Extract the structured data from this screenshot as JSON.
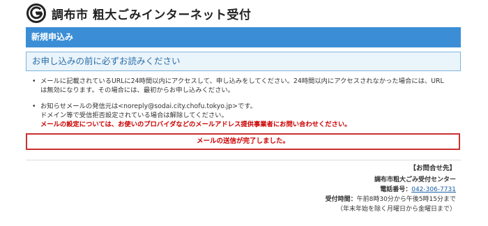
{
  "header": {
    "logo_icon": "chofu-city-logo-icon",
    "title": "調布市 粗大ごみインターネット受付"
  },
  "section": {
    "title": "新規申込み"
  },
  "notice": {
    "text": "お申し込みの前に必ずお読みください"
  },
  "instructions": {
    "item1_line1": "メールに記載されているURLに24時間以内にアクセスして、申し込みをしてください。24時間以内にアクセスされなかった場合には、URL",
    "item1_line2": "は無効になります。その場合には、最初からお申し込みください。",
    "item2_line1": "お知らせメールの発信元は<noreply@sodai.city.chofu.tokyo.jp>です。",
    "item2_line2": "ドメイン等で受信拒否設定されている場合は解除してください。",
    "item2_line3": "メールの設定については、お使いのプロバイダなどのメールアドレス提供事業者にお問い合わせください。"
  },
  "alert": {
    "text": "メールの送信が完了しました。"
  },
  "contact": {
    "heading": "【お問合せ先】",
    "center": "調布市粗大ごみ受付センター",
    "phone_label": "電話番号：",
    "phone": "042-306-7731",
    "hours_label": "受付時間：",
    "hours": "午前8時30分から午後5時15分まで",
    "hours_note": "（年末年始を除く月曜日から金曜日まで）"
  },
  "colors": {
    "bar": "#3b8ed6",
    "notice_bg": "#eaf4fb",
    "notice_text": "#2b6ea8",
    "alert": "#cc0000"
  }
}
